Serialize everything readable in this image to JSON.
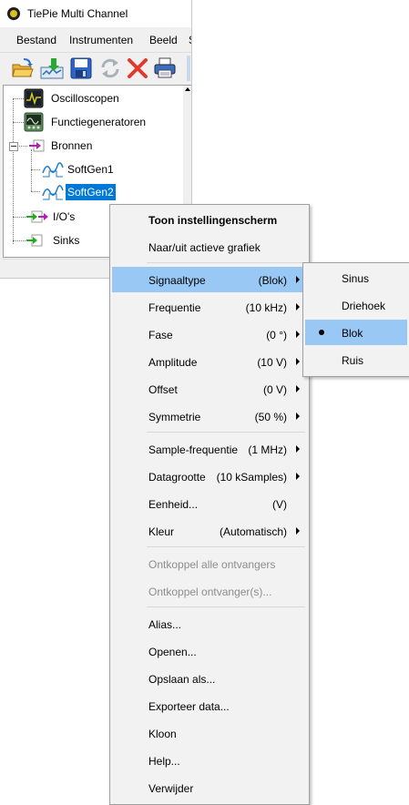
{
  "window": {
    "title": "TiePie Multi Channel"
  },
  "menubar": {
    "items": [
      "Bestand",
      "Instrumenten",
      "Beeld",
      "S"
    ]
  },
  "toolbar": {
    "buttons": [
      "open-folder-icon",
      "download-icon",
      "save-icon",
      "refresh-icon",
      "delete-icon",
      "print-icon"
    ]
  },
  "tree": {
    "items": [
      {
        "label": "Oscilloscopen",
        "icon": "oscilloscope-icon"
      },
      {
        "label": "Functiegeneratoren",
        "icon": "function-generator-icon"
      },
      {
        "label": "Bronnen",
        "icon": "source-arrow-icon"
      },
      {
        "label": "SoftGen1",
        "icon": "waveform-icon"
      },
      {
        "label": "SoftGen2",
        "icon": "waveform-icon",
        "selected": true
      },
      {
        "label": "I/O's",
        "icon": "io-arrows-icon"
      },
      {
        "label": "Sinks",
        "icon": "sink-arrow-icon"
      }
    ]
  },
  "context_menu": {
    "items": [
      {
        "label": "Toon instellingenscherm",
        "value": "",
        "bold": true
      },
      {
        "label": "Naar/uit actieve grafiek",
        "value": ""
      },
      {
        "label": "Signaaltype",
        "value": "(Blok)",
        "submenu": true,
        "highlighted": true
      },
      {
        "label": "Frequentie",
        "value": "(10 kHz)",
        "submenu": true
      },
      {
        "label": "Fase",
        "value": "(0 °)",
        "submenu": true
      },
      {
        "label": "Amplitude",
        "value": "(10 V)",
        "submenu": true
      },
      {
        "label": "Offset",
        "value": "(0 V)",
        "submenu": true
      },
      {
        "label": "Symmetrie",
        "value": "(50 %)",
        "submenu": true
      },
      {
        "label": "Sample-frequentie",
        "value": "(1 MHz)",
        "submenu": true
      },
      {
        "label": "Datagrootte",
        "value": "(10 kSamples)",
        "submenu": true
      },
      {
        "label": "Eenheid...",
        "value": "(V)"
      },
      {
        "label": "Kleur",
        "value": "(Automatisch)",
        "submenu": true
      },
      {
        "label": "Ontkoppel alle ontvangers",
        "value": "",
        "disabled": true
      },
      {
        "label": "Ontkoppel ontvanger(s)...",
        "value": "",
        "disabled": true
      },
      {
        "label": "Alias...",
        "value": ""
      },
      {
        "label": "Openen...",
        "value": ""
      },
      {
        "label": "Opslaan als...",
        "value": ""
      },
      {
        "label": "Exporteer data...",
        "value": ""
      },
      {
        "label": "Kloon",
        "value": ""
      },
      {
        "label": "Help...",
        "value": ""
      },
      {
        "label": "Verwijder",
        "value": ""
      }
    ]
  },
  "signal_submenu": {
    "items": [
      {
        "label": "Sinus"
      },
      {
        "label": "Driehoek"
      },
      {
        "label": "Blok",
        "checked": true
      },
      {
        "label": "Ruis"
      }
    ]
  },
  "colors": {
    "selection": "#0078d7",
    "menu_highlight": "#99c8f4",
    "disabled_text": "#8d8d8d"
  }
}
